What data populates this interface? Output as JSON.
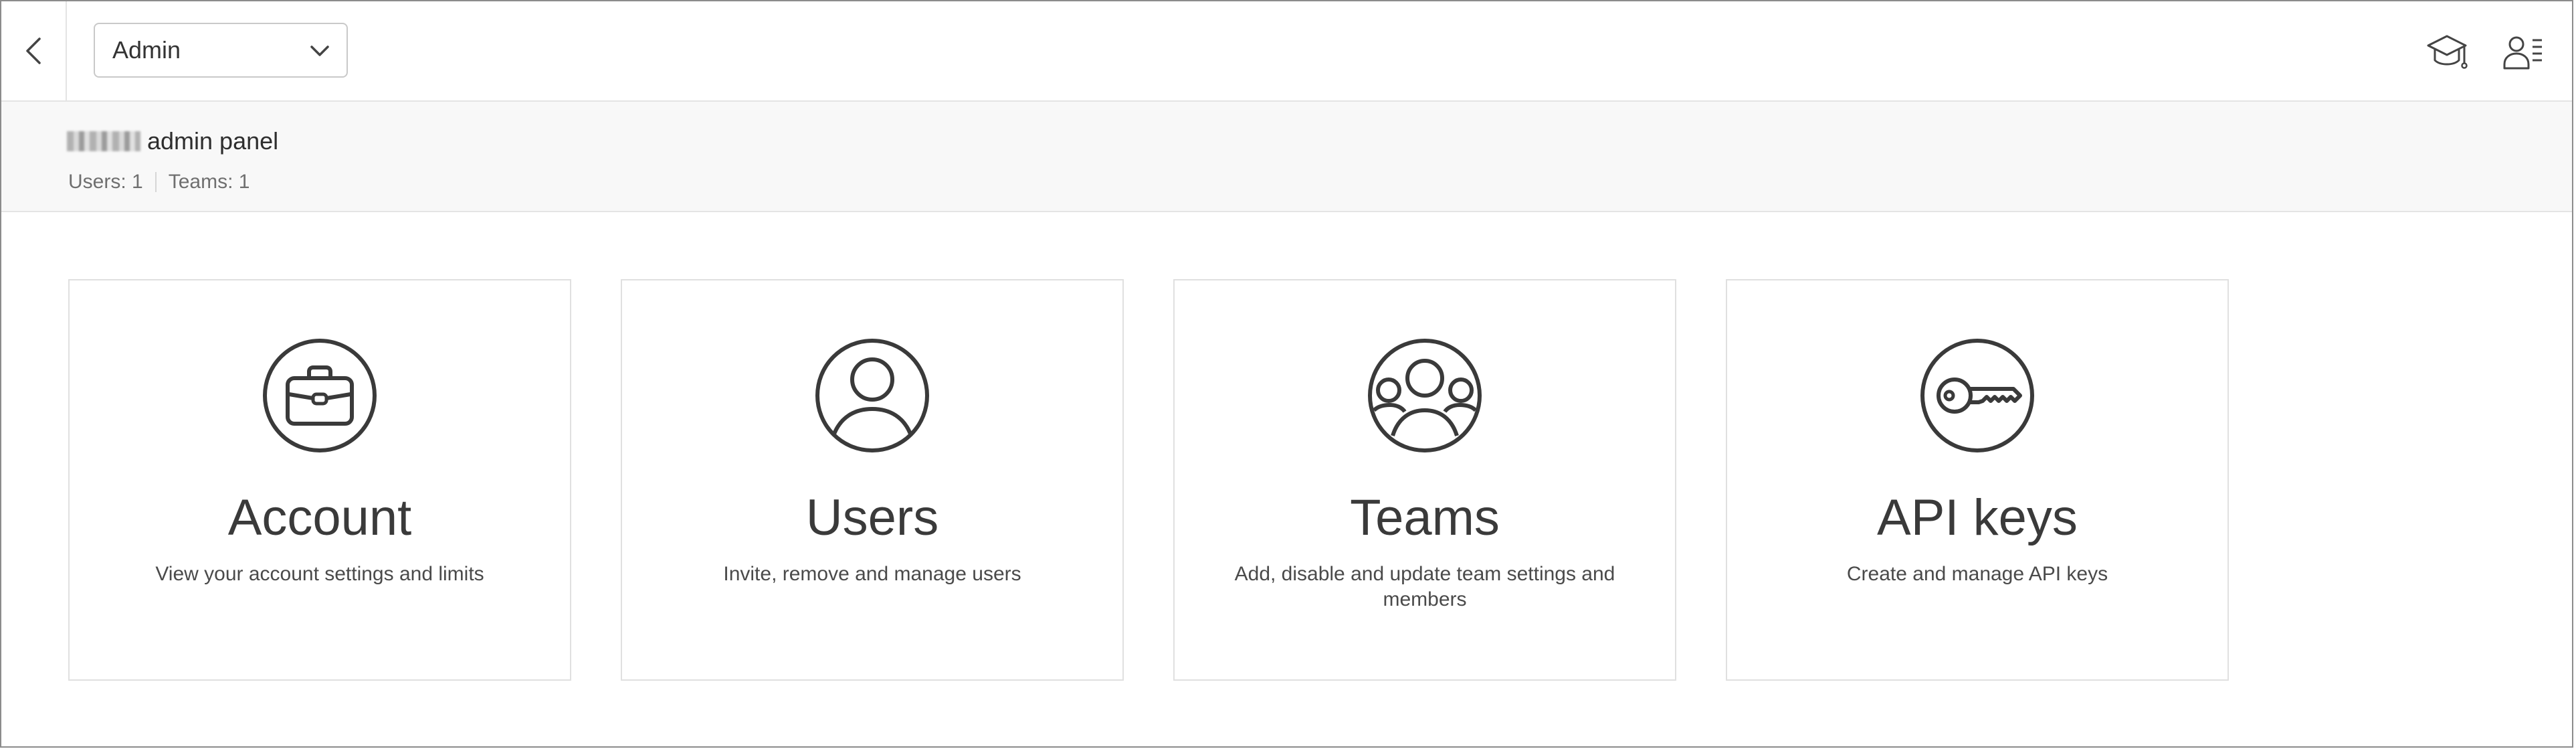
{
  "topbar": {
    "back_label": "",
    "dropdown_value": "Admin"
  },
  "subheader": {
    "title": "admin panel",
    "users_stat": "Users: 1",
    "teams_stat": "Teams: 1"
  },
  "cards": [
    {
      "title": "Account",
      "description": "View your account settings and limits",
      "icon": "briefcase-icon"
    },
    {
      "title": "Users",
      "description": "Invite, remove and manage users",
      "icon": "user-icon"
    },
    {
      "title": "Teams",
      "description": "Add, disable and update team settings and members",
      "icon": "team-icon"
    },
    {
      "title": "API keys",
      "description": "Create and manage API keys",
      "icon": "key-icon"
    }
  ],
  "icons": {
    "top_right": [
      "graduation-cap-icon",
      "user-list-icon"
    ]
  },
  "colors": {
    "icon_stroke": "#3a3a3a",
    "subheader_bg": "#f8f8f8",
    "border": "#e0e0e0"
  }
}
